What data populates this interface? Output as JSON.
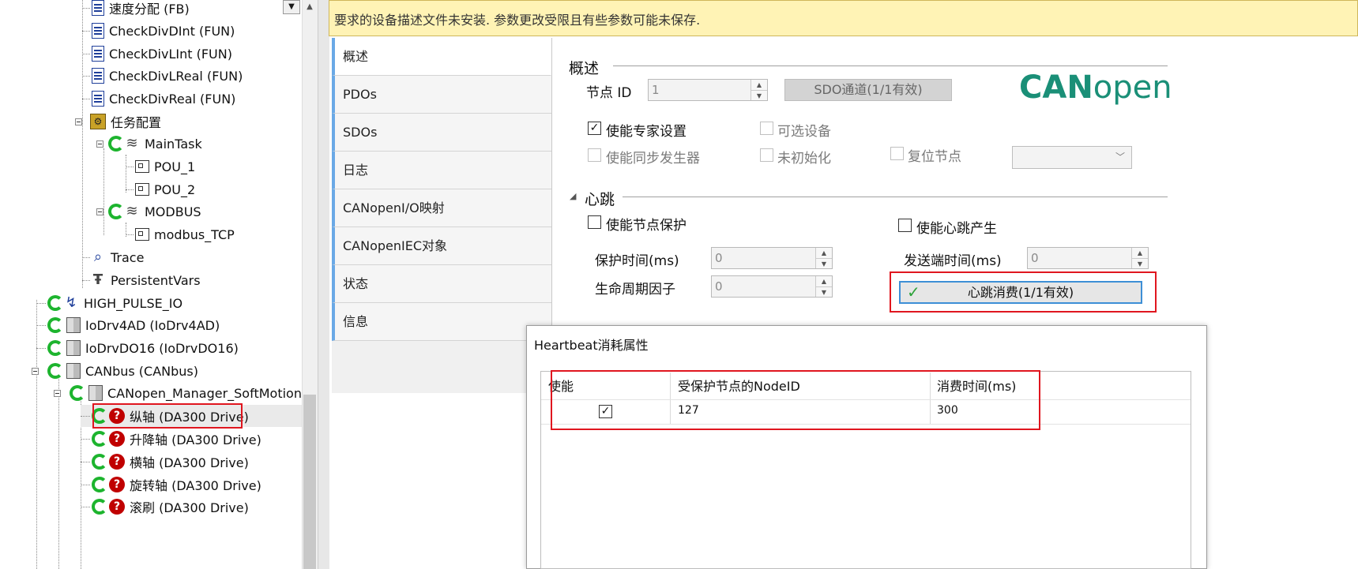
{
  "tree": {
    "items": [
      {
        "label": "速度分配 (FB)",
        "icon": "document-icon"
      },
      {
        "label": "CheckDivDInt (FUN)",
        "icon": "document-icon"
      },
      {
        "label": "CheckDivLInt (FUN)",
        "icon": "document-icon"
      },
      {
        "label": "CheckDivLReal (FUN)",
        "icon": "document-icon"
      },
      {
        "label": "CheckDivReal (FUN)",
        "icon": "document-icon"
      },
      {
        "label": "任务配置",
        "icon": "task-config-icon"
      },
      {
        "label": "MainTask",
        "icon": "task-icon"
      },
      {
        "label": "POU_1",
        "icon": "pou-icon"
      },
      {
        "label": "POU_2",
        "icon": "pou-icon"
      },
      {
        "label": "MODBUS",
        "icon": "task-icon"
      },
      {
        "label": "modbus_TCP",
        "icon": "pou-icon"
      },
      {
        "label": "Trace",
        "icon": "trace-icon"
      },
      {
        "label": "PersistentVars",
        "icon": "persistent-icon"
      },
      {
        "label": "HIGH_PULSE_IO",
        "icon": "io-icon"
      },
      {
        "label": "IoDrv4AD (IoDrv4AD)",
        "icon": "device-icon"
      },
      {
        "label": "IoDrvDO16 (IoDrvDO16)",
        "icon": "device-icon"
      },
      {
        "label": "CANbus (CANbus)",
        "icon": "device-icon"
      },
      {
        "label": "CANopen_Manager_SoftMotion (CAN",
        "icon": "device-icon"
      },
      {
        "label": "纵轴 (DA300 Drive)",
        "icon": "error-icon"
      },
      {
        "label": "升降轴 (DA300 Drive)",
        "icon": "error-icon"
      },
      {
        "label": "横轴 (DA300 Drive)",
        "icon": "error-icon"
      },
      {
        "label": "旋转轴 (DA300 Drive)",
        "icon": "error-icon"
      },
      {
        "label": "滚刷 (DA300 Drive)",
        "icon": "error-icon"
      }
    ]
  },
  "warning": "要求的设备描述文件未安装. 参数更改受限且有些参数可能未保存.",
  "tabs": [
    "概述",
    "PDOs",
    "SDOs",
    "日志",
    "CANopenI/O映射",
    "CANopenIEC对象",
    "状态",
    "信息"
  ],
  "overview": {
    "section_title": "概述",
    "node_id_label": "节点 ID",
    "node_id_value": "1",
    "sdo_button": "SDO通道(1/1有效)",
    "logo_bold": "CAN",
    "logo_thin": "open",
    "expert_label": "使能专家设置",
    "expert_check": "✓",
    "optional_label": "可选设备",
    "sync_label": "使能同步发生器",
    "no_init_label": "未初始化",
    "reset_label": "复位节点"
  },
  "heartbeat": {
    "section_title": "心跳",
    "collapse_glyph": "◢",
    "node_guard_label": "使能节点保护",
    "hb_produce_label": "使能心跳产生",
    "guard_time_label": "保护时间(ms)",
    "guard_time_value": "0",
    "life_factor_label": "生命周期因子",
    "life_factor_value": "0",
    "producer_time_label": "发送端时间(ms)",
    "producer_time_value": "0",
    "consume_button": "心跳消费(1/1有效)",
    "consume_check": "✓"
  },
  "dialog": {
    "title": "Heartbeat消耗属性",
    "columns": [
      "使能",
      "受保护节点的NodeID",
      "消费时间(ms)"
    ],
    "rows": [
      {
        "enable": "✓",
        "node_id": "127",
        "time": "300"
      }
    ]
  }
}
